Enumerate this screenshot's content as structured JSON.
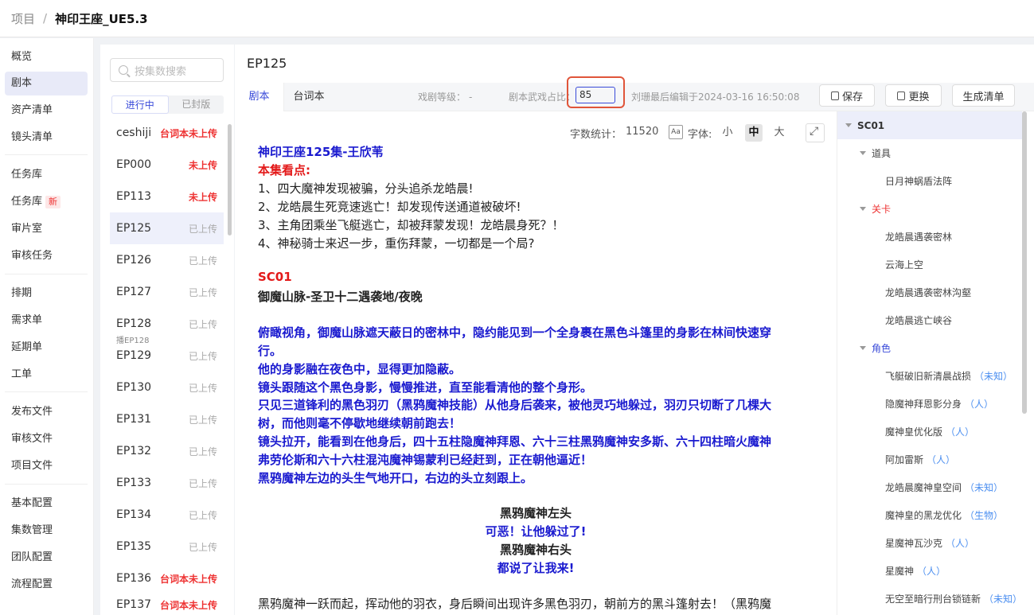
{
  "breadcrumb": {
    "root": "项目",
    "separator": "/",
    "current": "神印王座_UE5.3"
  },
  "sidebar": {
    "items": [
      {
        "label": "概览"
      },
      {
        "label": "剧本"
      },
      {
        "label": "资产清单"
      },
      {
        "label": "镜头清单"
      },
      {
        "label": "任务库"
      },
      {
        "label": "任务库",
        "badge": "新"
      },
      {
        "label": "审片室"
      },
      {
        "label": "审核任务"
      },
      {
        "label": "排期"
      },
      {
        "label": "需求单"
      },
      {
        "label": "延期单"
      },
      {
        "label": "工单"
      },
      {
        "label": "发布文件"
      },
      {
        "label": "审核文件"
      },
      {
        "label": "项目文件"
      },
      {
        "label": "基本配置"
      },
      {
        "label": "集数管理"
      },
      {
        "label": "团队配置"
      },
      {
        "label": "流程配置"
      }
    ]
  },
  "episodes": {
    "search_placeholder": "按集数搜索",
    "tabs": [
      "进行中",
      "已封版"
    ],
    "list": [
      {
        "name": "ceshiji",
        "status": "台词本未上传"
      },
      {
        "name": "EP000",
        "status": "未上传"
      },
      {
        "name": "EP113",
        "status": "未上传"
      },
      {
        "name": "EP125",
        "status": "已上传"
      },
      {
        "name": "EP126",
        "status": "已上传"
      },
      {
        "name": "EP127",
        "status": "已上传"
      },
      {
        "name": "EP128",
        "status": "已上传",
        "sub": "播EP128"
      },
      {
        "name": "EP129",
        "status": "已上传"
      },
      {
        "name": "EP130",
        "status": "已上传"
      },
      {
        "name": "EP131",
        "status": "已上传"
      },
      {
        "name": "EP132",
        "status": "已上传"
      },
      {
        "name": "EP133",
        "status": "已上传"
      },
      {
        "name": "EP134",
        "status": "已上传"
      },
      {
        "name": "EP135",
        "status": "已上传"
      },
      {
        "name": "EP136",
        "status": "台词本未上传"
      },
      {
        "name": "EP137",
        "status": "台词本未上传"
      }
    ]
  },
  "main": {
    "title": "EP125",
    "tabs": [
      "剧本",
      "台词本"
    ],
    "meta": {
      "grade_label": "戏剧等级：",
      "grade_value": "-",
      "ratio_label": "剧本武戏占比：",
      "ratio_value": "85",
      "edited": "刘珊最后编辑于2024-03-16 16:50:08"
    },
    "buttons": {
      "save": "保存",
      "replace": "更换",
      "generate": "生成清单"
    },
    "stats": {
      "count_label": "字数统计：",
      "count": "11520",
      "aa": "Aa",
      "font_label": "字体:",
      "small": "小",
      "medium": "中",
      "large": "大"
    }
  },
  "script": {
    "title": "神印王座125集-王欣苇",
    "highlight_label": "本集看点:",
    "points": [
      "1、四大魔神发现被骗，分头追杀龙皓晨!",
      "2、龙皓晨生死竞速逃亡！却发现传送通道被破坏!",
      "3、主角团乘坐飞艇逃亡，却被拜蒙发现！龙皓晨身死？！",
      "4、神秘骑士来迟一步，重伤拜蒙，一切都是一个局?"
    ],
    "scene_id": "SC01",
    "scene_heading": "御魔山脉-圣卫十二遇袭地/夜晚",
    "action_lines": [
      "俯瞰视角，御魔山脉遮天蔽日的密林中，隐约能见到一个全身裹在黑色斗篷里的身影在林间快速穿",
      "行。",
      "他的身影融在夜色中，显得更加隐蔽。",
      "镜头跟随这个黑色身影，慢慢推进，直至能看清他的整个身形。",
      "只见三道锋利的黑色羽刃（黑鸦魔神技能）从他身后袭来，被他灵巧地躲过，羽刃只切断了几棵大",
      "树，而他则毫不停歇地继续朝前跑去！",
      "镜头拉开，能看到在他身后，四十五柱隐魔神拜恩、六十三柱黑鸦魔神安多斯、六十四柱暗火魔神",
      "弗劳伦斯和六十六柱混沌魔神锡蒙利已经赶到，正在朝他逼近！",
      "黑鸦魔神左边的头生气地开口，右边的头立刻跟上。"
    ],
    "dialogue": [
      {
        "speaker": "黑鸦魔神左头",
        "line": "可恶！让他躲过了!"
      },
      {
        "speaker": "黑鸦魔神右头",
        "line": "都说了让我来!"
      }
    ],
    "last_line": "黑鸦魔神一跃而起，挥动他的羽衣，身后瞬间出现许多黑色羽刃，朝前方的黑斗篷射去！（黑鸦魔"
  },
  "outline": {
    "scene": "SC01",
    "groups": [
      {
        "label": "道具",
        "color": "gray",
        "items": [
          {
            "name": "日月神蜗盾法阵",
            "tag": ""
          }
        ]
      },
      {
        "label": "关卡",
        "color": "red",
        "items": [
          {
            "name": "龙皓晨遇袭密林",
            "tag": ""
          },
          {
            "name": "云海上空",
            "tag": ""
          },
          {
            "name": "龙皓晨遇袭密林沟壑",
            "tag": ""
          },
          {
            "name": "龙皓晨逃亡峡谷",
            "tag": ""
          }
        ]
      },
      {
        "label": "角色",
        "color": "blue",
        "items": [
          {
            "name": "飞艇破旧新清晨战损",
            "tag": "（未知）"
          },
          {
            "name": "隐魔神拜恩影分身",
            "tag": "（人）"
          },
          {
            "name": "魔神皇优化版",
            "tag": "（人）"
          },
          {
            "name": "阿加雷斯",
            "tag": "（人）"
          },
          {
            "name": "龙皓晨魔神皇空间",
            "tag": "（未知）"
          },
          {
            "name": "魔神皇的黑龙优化",
            "tag": "（生物）"
          },
          {
            "name": "星魔神瓦沙克",
            "tag": "（人）"
          },
          {
            "name": "星魔神",
            "tag": "（人）"
          },
          {
            "name": "无空至暗行刑台锁链新",
            "tag": "（未知）"
          }
        ]
      }
    ]
  },
  "colors": {
    "accent": "#3a4bd9",
    "danger": "#e33",
    "script_blue": "#1a1acf",
    "script_red": "#e31919",
    "highlight_box": "#e0553a"
  }
}
